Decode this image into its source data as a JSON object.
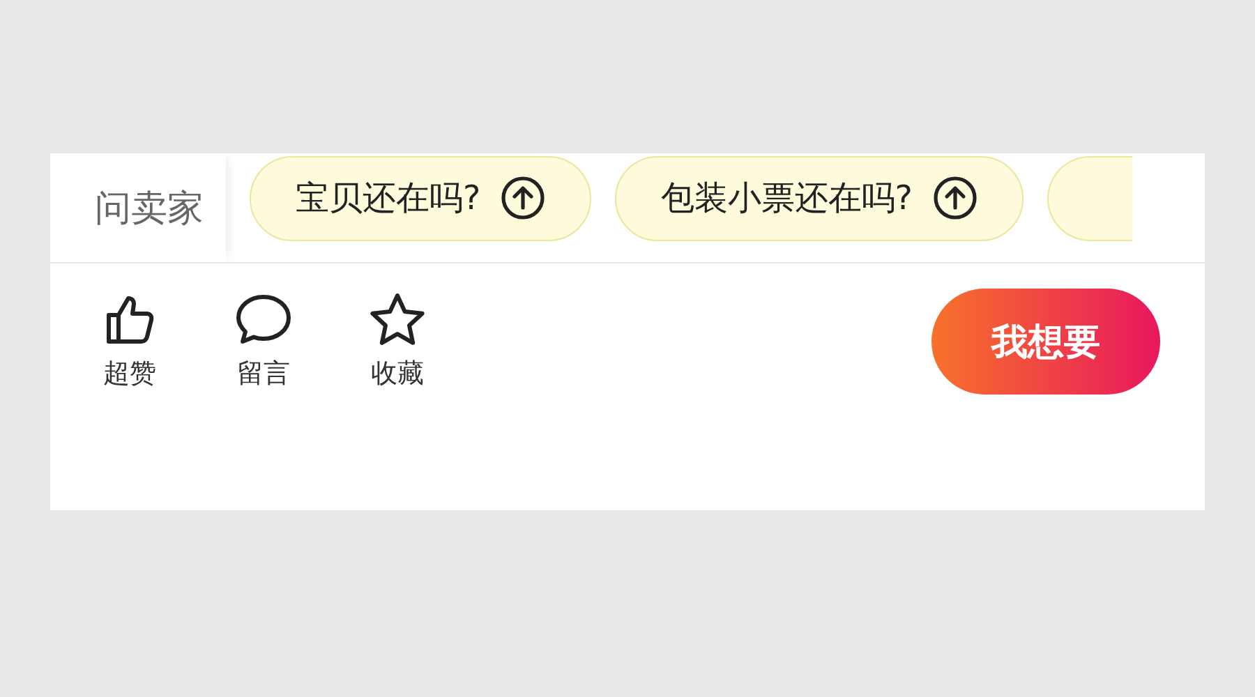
{
  "top_bar": {
    "ask_seller": "问卖家",
    "quick_questions": [
      {
        "label": "宝贝还在吗?"
      },
      {
        "label": "包装小票还在吗?"
      }
    ],
    "more_chip_visible": true
  },
  "actions": [
    {
      "kind": "like",
      "label": "超赞"
    },
    {
      "kind": "comment",
      "label": "留言"
    },
    {
      "kind": "favorite",
      "label": "收藏"
    }
  ],
  "want_button": "我想要"
}
